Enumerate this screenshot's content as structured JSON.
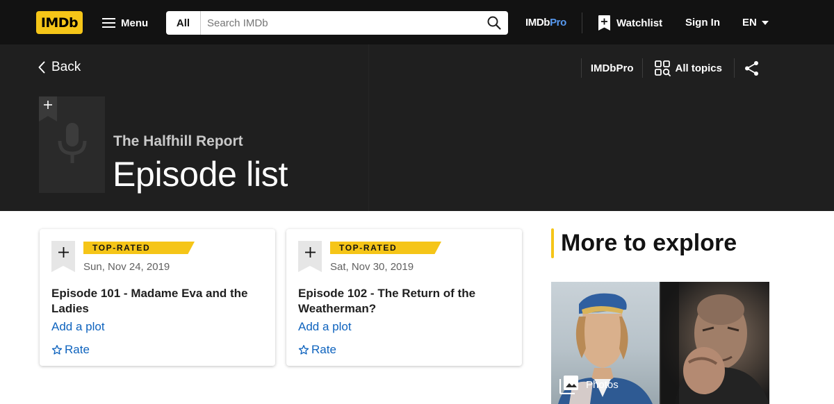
{
  "nav": {
    "logo": "IMDb",
    "menu_label": "Menu",
    "search_category": "All",
    "search_placeholder": "Search IMDb",
    "pro_logo_a": "IMDb",
    "pro_logo_b": "Pro",
    "watchlist_label": "Watchlist",
    "signin_label": "Sign In",
    "language": "EN"
  },
  "hero": {
    "back_label": "Back",
    "sub_nav": {
      "imdbpro_label": "IMDbPro",
      "all_topics_label": "All topics"
    },
    "series_title": "The Halfhill Report",
    "page_title": "Episode list"
  },
  "episodes": [
    {
      "badge": "TOP-RATED",
      "date": "Sun, Nov 24, 2019",
      "title": "Episode 101 - Madame Eva and the Ladies",
      "plot_link": "Add a plot",
      "rate_label": "Rate"
    },
    {
      "badge": "TOP-RATED",
      "date": "Sat, Nov 30, 2019",
      "title": "Episode 102 - The Return of the Weatherman?",
      "plot_link": "Add a plot",
      "rate_label": "Rate"
    }
  ],
  "sidebar": {
    "title": "More to explore",
    "photos_label": "Photos"
  },
  "colors": {
    "brand_yellow": "#f5c518",
    "link_blue": "#0e63be",
    "nav_bg": "#121212",
    "hero_bg": "#1f1f1f"
  }
}
